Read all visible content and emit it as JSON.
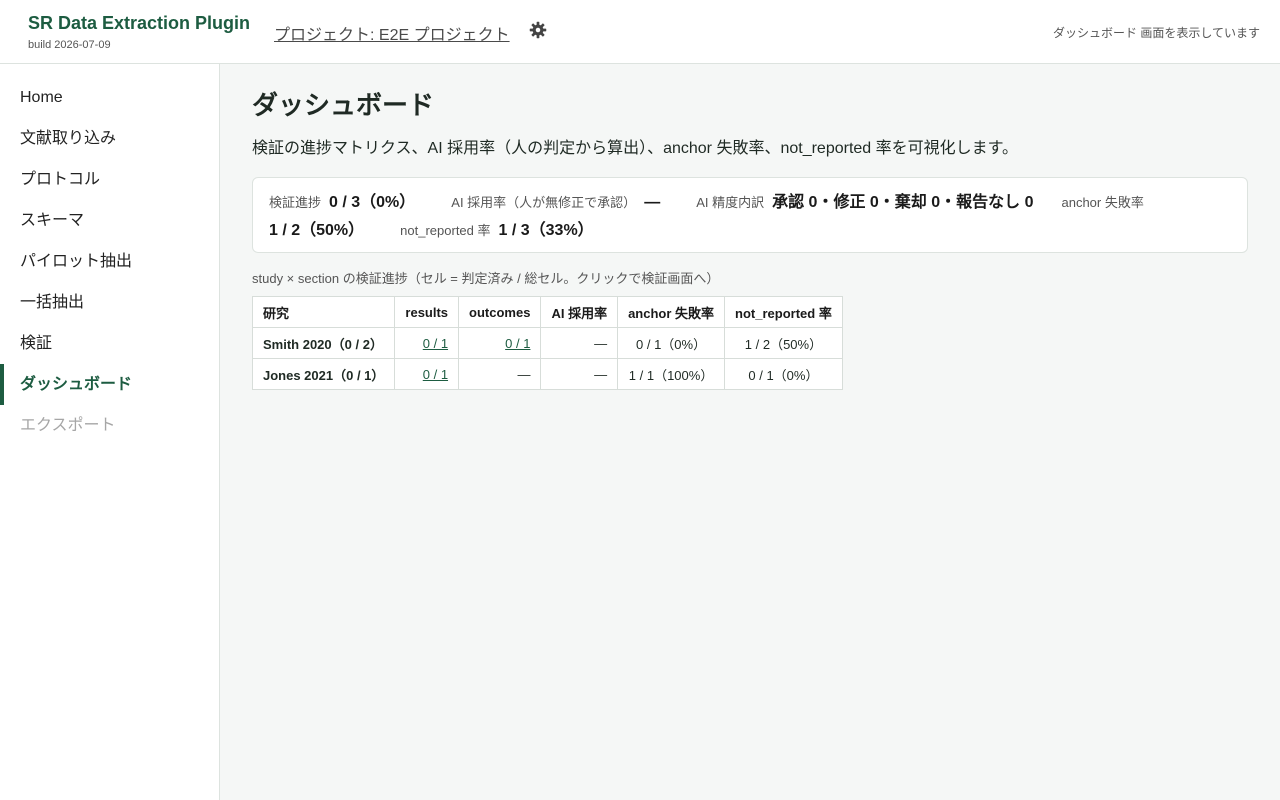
{
  "header": {
    "app_title": "SR Data Extraction Plugin",
    "build": "build 2026-07-09",
    "project_link": "プロジェクト: E2E プロジェクト",
    "status_text": "ダッシュボード 画面を表示しています"
  },
  "sidebar": {
    "items": [
      {
        "label": "Home"
      },
      {
        "label": "文献取り込み"
      },
      {
        "label": "プロトコル"
      },
      {
        "label": "スキーマ"
      },
      {
        "label": "パイロット抽出"
      },
      {
        "label": "一括抽出"
      },
      {
        "label": "検証"
      },
      {
        "label": "ダッシュボード",
        "active": true
      },
      {
        "label": "エクスポート",
        "disabled": true
      }
    ]
  },
  "main": {
    "title": "ダッシュボード",
    "description": "検証の進捗マトリクス、AI 採用率（人の判定から算出）、anchor 失敗率、not_reported 率を可視化します。",
    "summary": {
      "progress_label": "検証進捗",
      "progress_value": "0 / 3（0%）",
      "ai_adoption_label": "AI 採用率（人が無修正で承認）",
      "ai_adoption_value": "—",
      "ai_breakdown_label": "AI 精度内訳",
      "ai_breakdown_value": "承認 0・修正 0・棄却 0・報告なし 0",
      "anchor_fail_label": "anchor 失敗率",
      "anchor_fail_value": "1 / 2（50%）",
      "not_reported_label": "not_reported 率",
      "not_reported_value": "1 / 3（33%）"
    },
    "matrix": {
      "caption": "study × section の検証進捗（セル = 判定済み / 総セル。クリックで検証画面へ）",
      "headers": [
        "研究",
        "results",
        "outcomes",
        "AI 採用率",
        "anchor 失敗率",
        "not_reported 率"
      ],
      "rows": [
        {
          "study": "Smith 2020（0 / 2）",
          "results": "0 / 1",
          "outcomes": "0 / 1",
          "ai_rate": "—",
          "anchor": "0 / 1（0%）",
          "not_reported": "1 / 2（50%）"
        },
        {
          "study": "Jones 2021（0 / 1）",
          "results": "0 / 1",
          "outcomes": "—",
          "ai_rate": "—",
          "anchor": "1 / 1（100%）",
          "not_reported": "0 / 1（0%）"
        }
      ]
    }
  },
  "colors": {
    "accent": "#1d5c41",
    "disabled": "#a6a6a6"
  },
  "icons": {
    "project_settings": "gear-icon"
  }
}
